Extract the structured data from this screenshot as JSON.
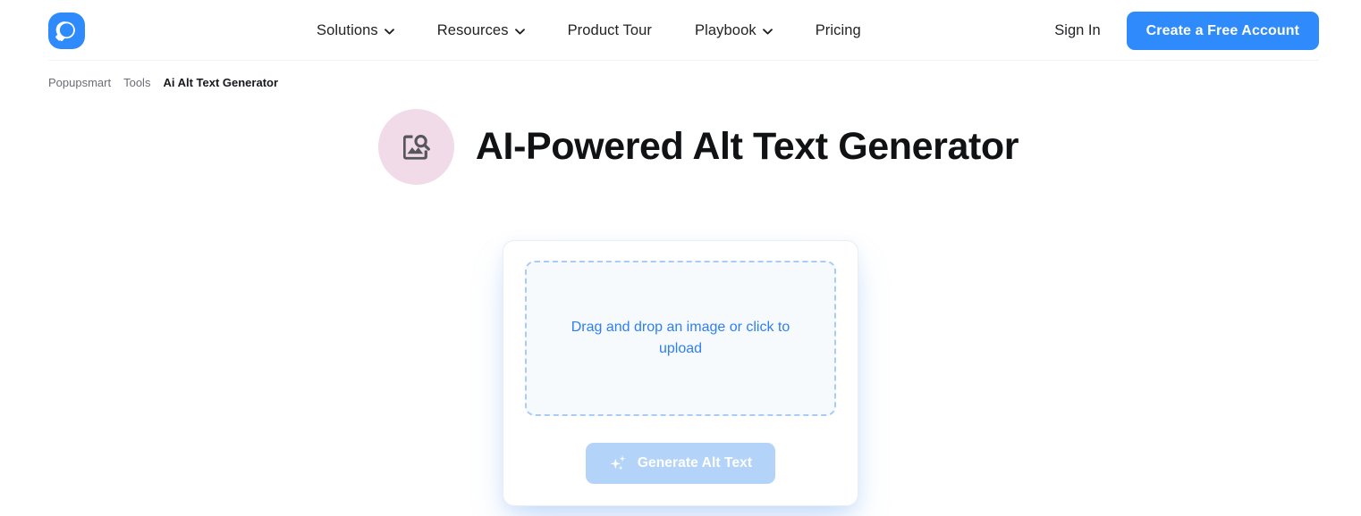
{
  "header": {
    "logo_icon": "popupsmart-logo-icon",
    "brand_color": "#2f8bfb",
    "nav": [
      {
        "label": "Solutions",
        "has_dropdown": true
      },
      {
        "label": "Resources",
        "has_dropdown": true
      },
      {
        "label": "Product Tour",
        "has_dropdown": false
      },
      {
        "label": "Playbook",
        "has_dropdown": true
      },
      {
        "label": "Pricing",
        "has_dropdown": false
      }
    ],
    "sign_in_label": "Sign In",
    "cta_label": "Create a Free Account"
  },
  "breadcrumb": {
    "items": [
      {
        "label": "Popupsmart",
        "current": false
      },
      {
        "label": "Tools",
        "current": false
      },
      {
        "label": "Ai Alt Text Generator",
        "current": true
      }
    ]
  },
  "hero": {
    "badge_icon": "image-search-icon",
    "badge_color": "#f1dbe8",
    "title": "AI-Powered Alt Text Generator"
  },
  "tool": {
    "dropzone": {
      "text": "Drag and drop an image or click to upload",
      "border_color": "#a9ccf6",
      "text_color": "#2e7ff0",
      "background": "#f7fafd"
    },
    "generate_button": {
      "label": "Generate Alt Text",
      "icon": "sparkles-icon",
      "disabled": true,
      "background": "#b3d4f8",
      "text_color": "#ffffff"
    }
  }
}
